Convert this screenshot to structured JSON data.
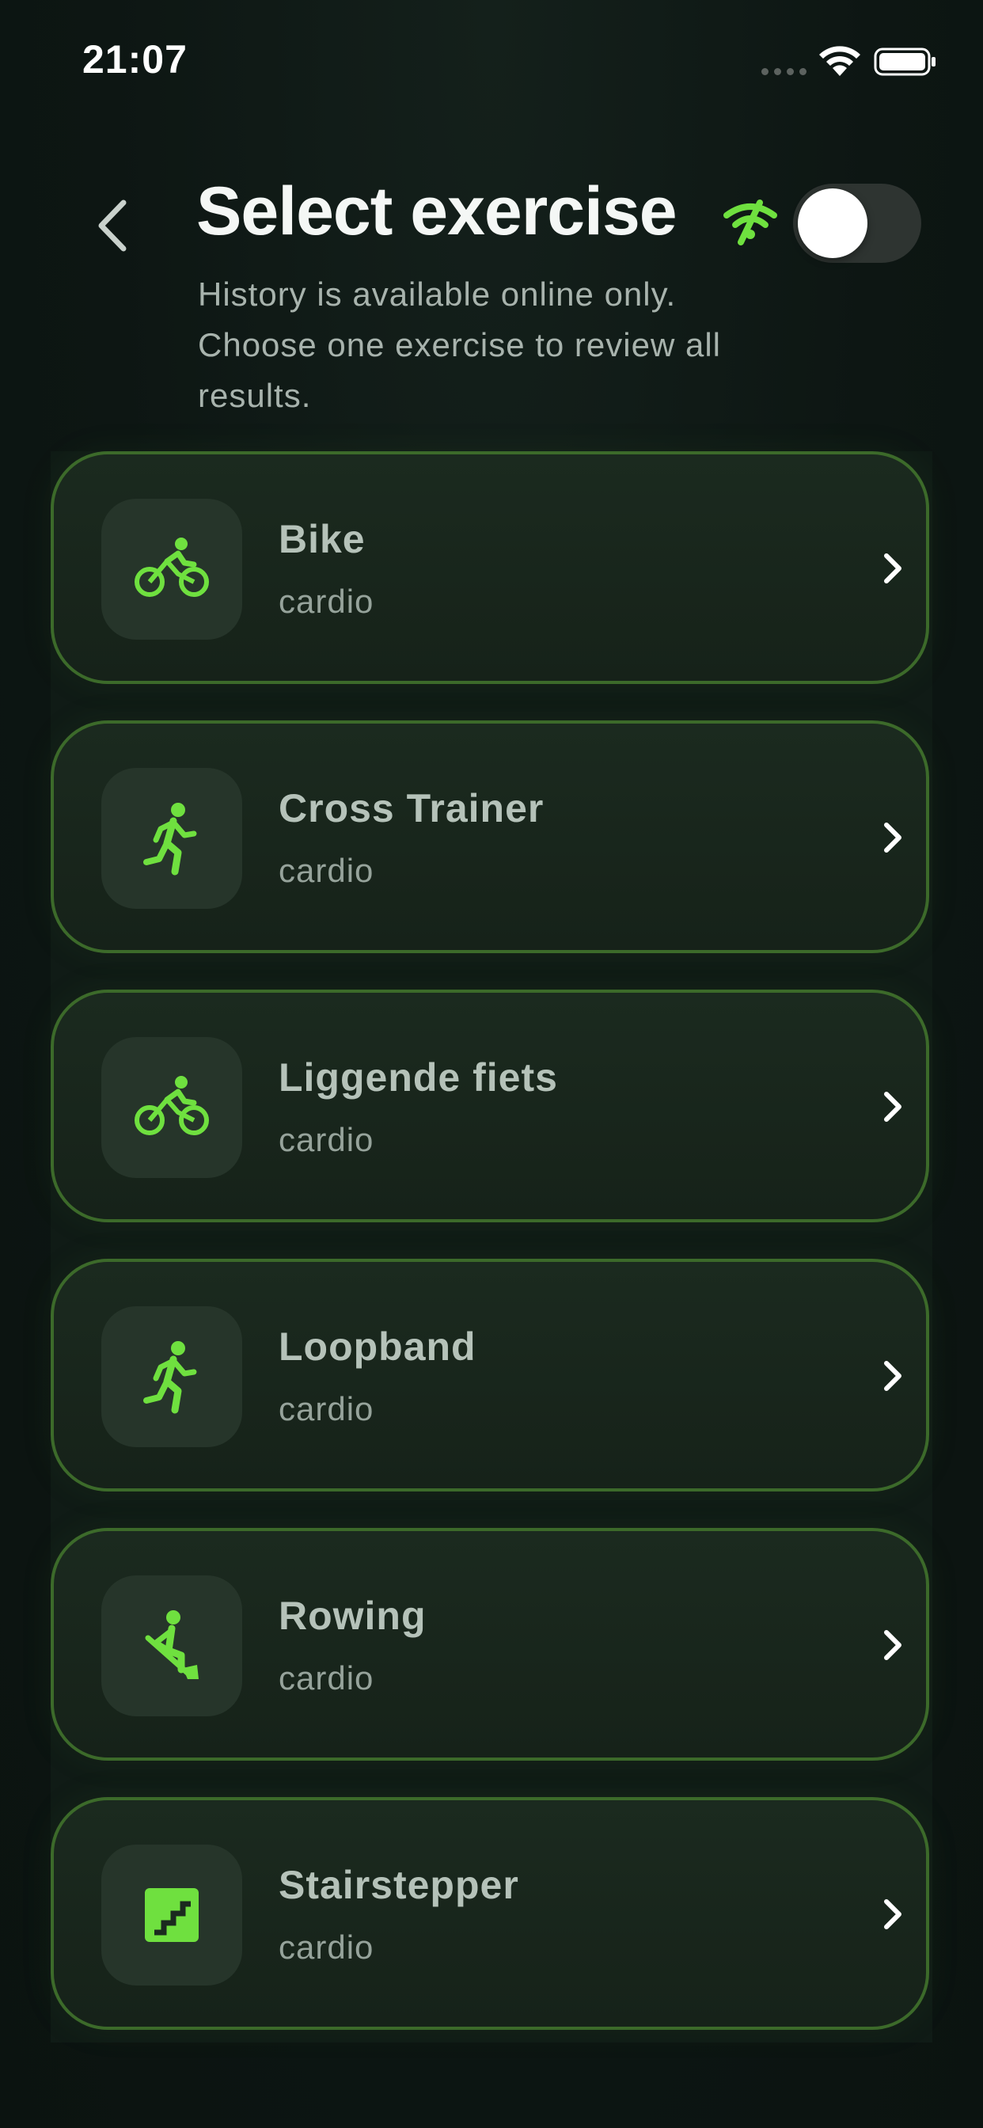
{
  "status_bar": {
    "time": "21:07"
  },
  "header": {
    "title": "Select exercise",
    "subtitle": "History is available online only. Choose one exercise to review all results.",
    "online_toggle_on": false
  },
  "colors": {
    "accent": "#6fe03f",
    "card_border": "#3c6a2a",
    "background": "#0c1512"
  },
  "exercises": [
    {
      "name": "Bike",
      "category": "cardio",
      "icon": "bike-icon"
    },
    {
      "name": "Cross Trainer",
      "category": "cardio",
      "icon": "running-icon"
    },
    {
      "name": "Liggende fiets",
      "category": "cardio",
      "icon": "bike-icon"
    },
    {
      "name": "Loopband",
      "category": "cardio",
      "icon": "running-icon"
    },
    {
      "name": "Rowing",
      "category": "cardio",
      "icon": "rowing-icon"
    },
    {
      "name": "Stairstepper",
      "category": "cardio",
      "icon": "stairs-icon"
    }
  ]
}
